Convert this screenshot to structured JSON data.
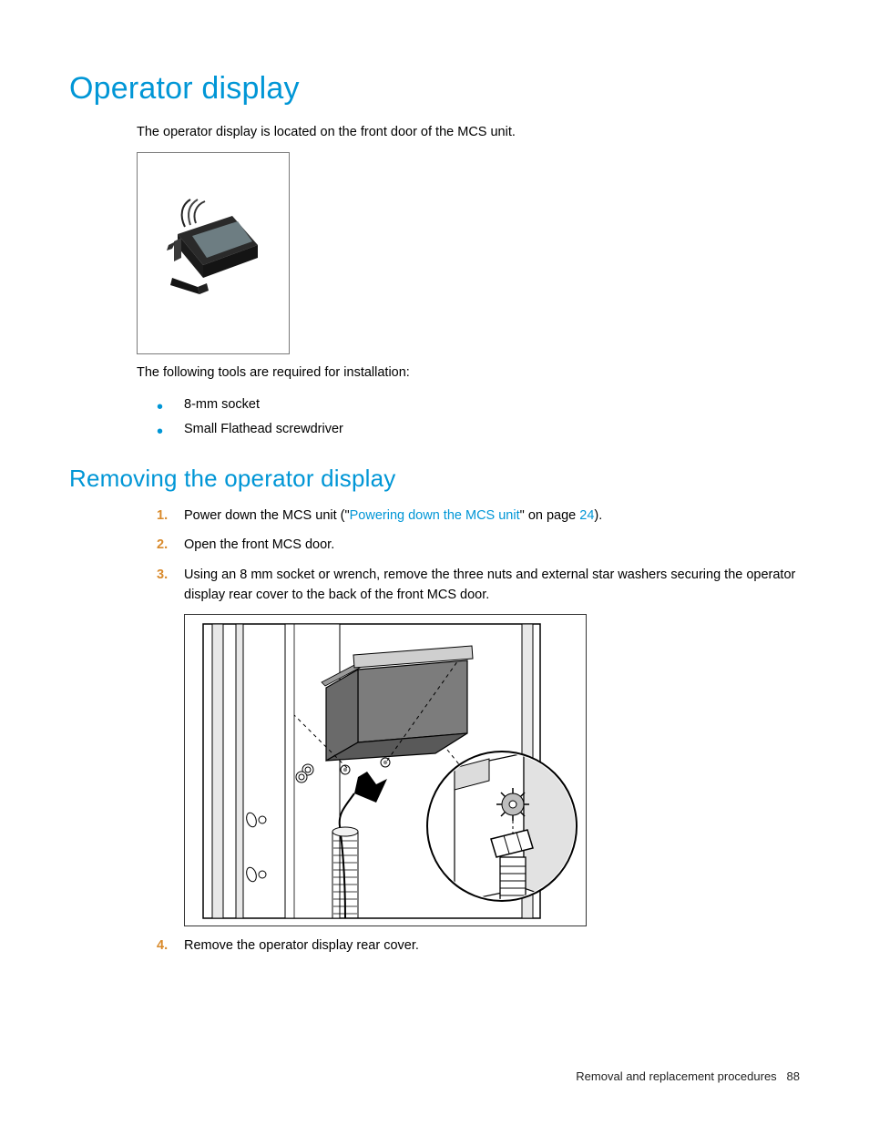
{
  "heading1": "Operator display",
  "intro": "The operator display is located on the front door of the MCS unit.",
  "tools_intro": "The following tools are required for installation:",
  "tools": [
    "8-mm socket",
    "Small Flathead screwdriver"
  ],
  "heading2": "Removing the operator display",
  "steps": {
    "s1_a": "Power down the MCS unit (\"",
    "s1_link": "Powering down the MCS unit",
    "s1_b": "\" on page ",
    "s1_page": "24",
    "s1_c": ").",
    "s2": "Open the front MCS door.",
    "s3": "Using an 8 mm socket or wrench, remove the three nuts and external star washers securing the operator display rear cover to the back of the front MCS door.",
    "s4": "Remove the operator display rear cover."
  },
  "footer_section": "Removal and replacement procedures",
  "footer_page": "88"
}
